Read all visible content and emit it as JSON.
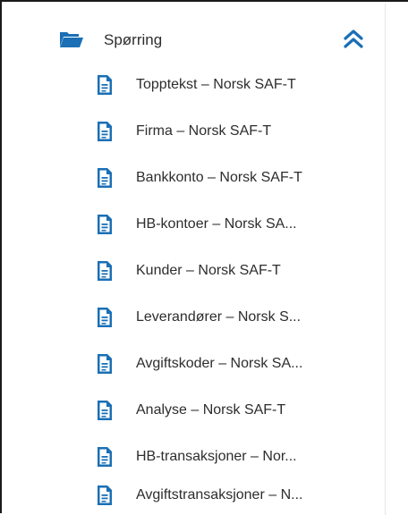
{
  "section": {
    "title": "Spørring",
    "folder_icon": "folder-open-icon",
    "collapse_icon": "double-chevron-up-icon",
    "accent_color": "#1a6fb5"
  },
  "items": [
    {
      "label": "Topptekst – Norsk SAF-T",
      "icon": "document-icon"
    },
    {
      "label": "Firma – Norsk SAF-T",
      "icon": "document-icon"
    },
    {
      "label": "Bankkonto – Norsk SAF-T",
      "icon": "document-icon"
    },
    {
      "label": "HB-kontoer – Norsk SA...",
      "icon": "document-icon"
    },
    {
      "label": "Kunder – Norsk SAF-T",
      "icon": "document-icon"
    },
    {
      "label": "Leverandører – Norsk S...",
      "icon": "document-icon"
    },
    {
      "label": "Avgiftskoder – Norsk SA...",
      "icon": "document-icon"
    },
    {
      "label": "Analyse – Norsk SAF-T",
      "icon": "document-icon"
    },
    {
      "label": "HB-transaksjoner – Nor...",
      "icon": "document-icon"
    },
    {
      "label": "Avgiftstransaksjoner – N...",
      "icon": "document-icon"
    }
  ]
}
